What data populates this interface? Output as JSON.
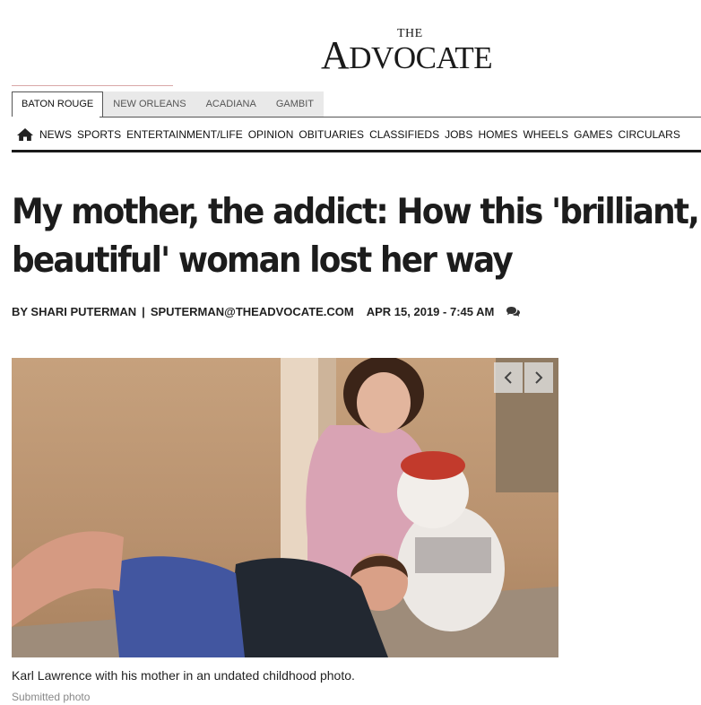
{
  "masthead": {
    "logo_the": "THE",
    "logo_a": "A",
    "logo_rest": "DVOCATE"
  },
  "edition_tabs": [
    {
      "label": "BATON ROUGE",
      "active": true
    },
    {
      "label": "NEW ORLEANS",
      "active": false
    },
    {
      "label": "ACADIANA",
      "active": false
    },
    {
      "label": "GAMBIT",
      "active": false
    }
  ],
  "nav": {
    "home_icon": "home-icon",
    "items": [
      "NEWS",
      "SPORTS",
      "ENTERTAINMENT/LIFE",
      "OPINION",
      "OBITUARIES",
      "CLASSIFIEDS",
      "JOBS",
      "HOMES",
      "WHEELS",
      "GAMES",
      "CIRCULARS"
    ]
  },
  "article": {
    "headline_line1": "My mother, the addict: How this 'brilliant,",
    "headline_line2": "beautiful' woman lost her way",
    "byline_author": "BY SHARI PUTERMAN",
    "byline_separator": "|",
    "byline_email": "SPUTERMAN@THEADVOCATE.COM",
    "byline_date": "APR 15, 2019 - 7:45 AM",
    "comment_icon": "comment-icon"
  },
  "gallery": {
    "prev_icon": "chevron-left-icon",
    "next_icon": "chevron-right-icon",
    "caption": "Karl Lawrence with his mother in an undated childhood photo.",
    "credit": "Submitted photo"
  },
  "colors": {
    "nav_rule": "#1a1a1a",
    "tab_inactive": "#e9e9e9",
    "masthead_accent": "#d9a8a8"
  }
}
